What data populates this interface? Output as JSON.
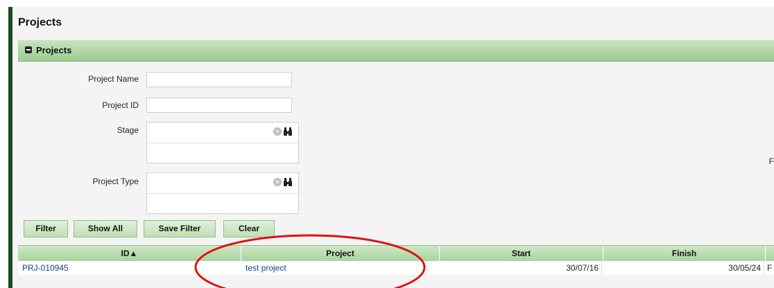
{
  "page": {
    "title": "Projects"
  },
  "panel": {
    "title": "Projects"
  },
  "filters": {
    "project_name_label": "Project Name",
    "project_id_label": "Project ID",
    "stage_label": "Stage",
    "project_type_label": "Project Type",
    "project_name_value": "",
    "project_id_value": "",
    "right_truncated_label": "F"
  },
  "icons": {
    "clear": "clear-circle-icon",
    "lookup": "binoculars-icon"
  },
  "buttons": {
    "filter": "Filter",
    "show_all": "Show All",
    "save_filter": "Save Filter",
    "clear": "Clear"
  },
  "grid": {
    "columns": [
      "ID▲",
      "Project",
      "Start",
      "Finish"
    ],
    "rows": [
      {
        "id": "PRJ-010945",
        "project": "test project",
        "start": "30/07/16",
        "finish": "30/05/24",
        "trailing": "F"
      }
    ]
  },
  "colors": {
    "accent_green": "#9ccc8f",
    "annotation_red": "#e01010",
    "left_bar": "#1f4a1f"
  }
}
